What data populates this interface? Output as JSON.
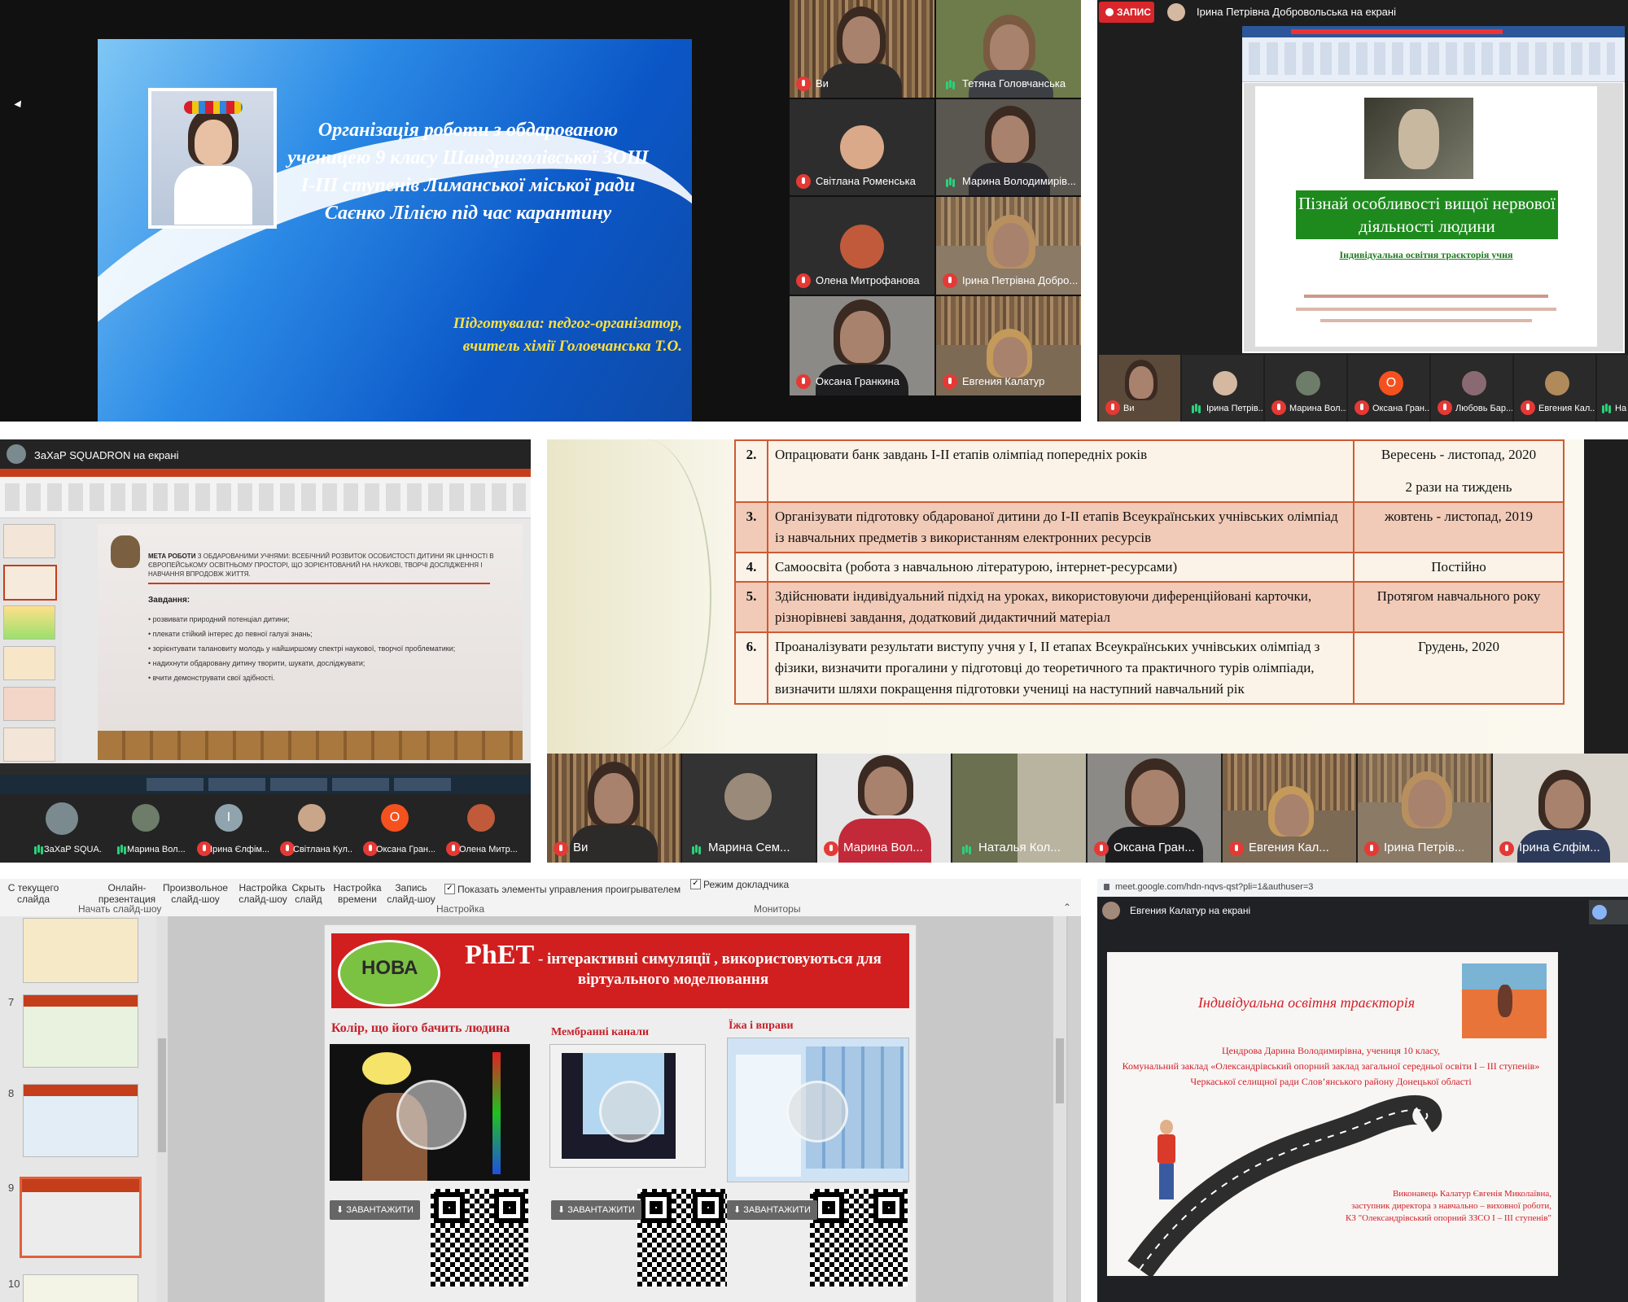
{
  "panel1": {
    "slide_title": "Організація роботи з обдарованою ученицею 9 класу Шандриголівської ЗОШ І-ІІІ ступенів Лиманської міської ради Саєнко Лілією під час карантину",
    "author": "Підготувала: педгог-організатор, вчитель хімії Головчанська Т.О.",
    "participants": [
      {
        "name": "Ви"
      },
      {
        "name": "Тетяна Головчанська"
      },
      {
        "name": "Світлана Роменська"
      },
      {
        "name": "Марина Володимирів..."
      },
      {
        "name": "Олена Митрофанова"
      },
      {
        "name": "Ірина Петрівна Добро..."
      },
      {
        "name": "Оксана Гранкина"
      },
      {
        "name": "Евгения Калатур"
      }
    ]
  },
  "panel2": {
    "record_label": "ЗАПИС",
    "presenter": "Ірина Петрівна Добровольська на екрані",
    "doc_title": "Пізнай особливості вищої нервової діяльності людини",
    "doc_subtitle": "Індивідуальна освітня траєкторія учня",
    "strip": [
      {
        "name": "Ви"
      },
      {
        "name": "Ірина Петрів..."
      },
      {
        "name": "Марина Вол..."
      },
      {
        "name": "Оксана Гран...",
        "initial": "О"
      },
      {
        "name": "Любовь Бар..."
      },
      {
        "name": "Евгения Кал..."
      },
      {
        "name": "На"
      }
    ]
  },
  "panel3": {
    "presenter": "ЗаХаР SQUADRON на екрані",
    "goal_label": "МЕТА РОБОТИ",
    "goal_text": "З ОБДАРОВАНИМИ УЧНЯМИ: ВСЕБІЧНИЙ РОЗВИТОК ОСОБИСТОСТІ ДИТИНИ ЯК ЦІННОСТІ В ЄВРОПЕЙСЬКОМУ ОСВІТНЬОМУ ПРОСТОРІ, ЩО ЗОРІЄНТОВАНИЙ НА НАУКОВІ, ТВОРЧІ ДОСЛІДЖЕННЯ І НАВЧАННЯ ВПРОДОВЖ ЖИТТЯ.",
    "tasks_label": "Завдання:",
    "tasks": [
      "розвивати природний потенціал дитини;",
      "плекати стійкий інтерес до певної галузі знань;",
      "зорієнтувати талановиту молодь у найширшому спектрі наукової, творчої проблематики;",
      "надихнути обдаровану дитину творити, шукати, досліджувати;",
      "вчити демонструвати свої здібності."
    ],
    "strip": [
      {
        "name": "ЗаХаР SQUA..."
      },
      {
        "name": "Марина Вол..."
      },
      {
        "name": "Ірина Єлфім...",
        "initial": "І"
      },
      {
        "name": "Світлана Кул..."
      },
      {
        "name": "Оксана Гран...",
        "initial": "О"
      },
      {
        "name": "Олена Митр..."
      }
    ]
  },
  "panel4": {
    "rows": [
      {
        "num": "2.",
        "task": "Опрацювати банк завдань І-ІІ етапів олімпіад попередніх років",
        "when": "Вересень - листопад, 2020",
        "when2": "2 рази на тиждень"
      },
      {
        "num": "3.",
        "task": "Організувати підготовку обдарованої дитини до І-ІІ етапів Всеукраїнських учнівських олімпіад із навчальних предметів з використанням електронних ресурсів",
        "when": "жовтень - листопад, 2019"
      },
      {
        "num": "4.",
        "task": "Самоосвіта (робота з навчальною літературою, інтернет-ресурсами)",
        "when": "Постійно"
      },
      {
        "num": "5.",
        "task": "Здійснювати індивідуальний підхід на уроках, використовуючи диференційовані карточки, різнорівневі завдання, додатковий дидактичний матеріал",
        "when": "Протягом навчального року"
      },
      {
        "num": "6.",
        "task": "Проаналізувати результати виступу учня у І, ІІ етапах Всеукраїнських учнівських олімпіад з фізики, визначити прогалини у підготовці до теоретичного та практичного турів олімпіади, визначити шляхи покращення підготовки учениці на наступний навчальний рік",
        "when": "Грудень, 2020"
      }
    ],
    "strip": [
      {
        "name": "Ви"
      },
      {
        "name": "Марина Сем..."
      },
      {
        "name": "Марина Вол..."
      },
      {
        "name": "Наталья Кол..."
      },
      {
        "name": "Оксана Гран..."
      },
      {
        "name": "Евгения Кал..."
      },
      {
        "name": "Ірина Петрів..."
      },
      {
        "name": "Ірина Єлфім..."
      }
    ]
  },
  "panel5": {
    "toolbar": [
      "С текущего слайда",
      "Онлайн-презентация",
      "Произвольное слайд-шоу",
      "Настройка слайд-шоу",
      "Скрыть слайд",
      "Настройка времени",
      "Запись слайд-шоу"
    ],
    "show_controls": "Показать элементы управления проигрывателем",
    "presenter_mode": "Режим докладчика",
    "group_start": "Начать слайд-шоу",
    "group_setup": "Настройка",
    "group_monitors": "Мониторы",
    "slide_numbers": [
      "7",
      "8",
      "9",
      "10"
    ],
    "logo_text": "НОВА",
    "header_main": "PhET",
    "header_rest": " - інтерактивні симуляції , використовуються для віртуального моделювання",
    "sims": [
      {
        "title": "Колір, що його бачить людина",
        "button": "ЗАВАНТАЖИТИ"
      },
      {
        "title": "Мембранні канали",
        "button": "ЗАВАНТАЖИТИ"
      },
      {
        "title": "Їжа і вправи",
        "button": "ЗАВАНТАЖИТИ"
      }
    ]
  },
  "panel6": {
    "url": "meet.google.com/hdn-nqvs-qst?pli=1&authuser=3",
    "presenter": "Евгения Калатур на екрані",
    "slide_title": "Індивідуальна освітня траєкторія",
    "student": "Цендрова Дарина Володимирівна, учениця 10 класу,",
    "school": "Комунальний заклад «Олександрівський опорний заклад загальної середньої освіти І – ІІІ ступенів»",
    "council": "Черкаської селищної ради Слов’янського району Донецької області",
    "executor": "Виконавець Калатур Євгенія Миколаївна,",
    "position": "заступник директора з навчально – виховної роботи,",
    "institution": "КЗ \"Олександрівський опорний ЗЗСО І – ІІІ ступенів\""
  }
}
